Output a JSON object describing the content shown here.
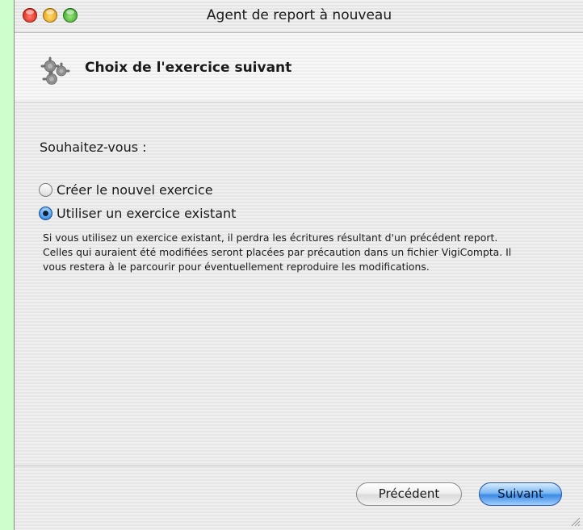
{
  "window": {
    "title": "Agent de report à nouveau"
  },
  "header": {
    "title": "Choix de l'exercice suivant",
    "icon": "gear-cluster-icon"
  },
  "content": {
    "prompt": "Souhaitez-vous :",
    "options": [
      {
        "label": "Créer le nouvel exercice",
        "selected": false
      },
      {
        "label": "Utiliser un exercice existant",
        "selected": true
      }
    ],
    "description": "Si vous utilisez un exercice existant, il perdra les écritures résultant d'un précédent report. Celles qui auraient été modifiées seront placées par précaution dans un fichier VigiCompta. Il vous restera à le parcourir pour éventuellement reproduire les modifications."
  },
  "buttons": {
    "previous_label": "Précédent",
    "next_label": "Suivant"
  },
  "colors": {
    "background": "#ccffcc",
    "default_button": "#3d8ae3"
  }
}
